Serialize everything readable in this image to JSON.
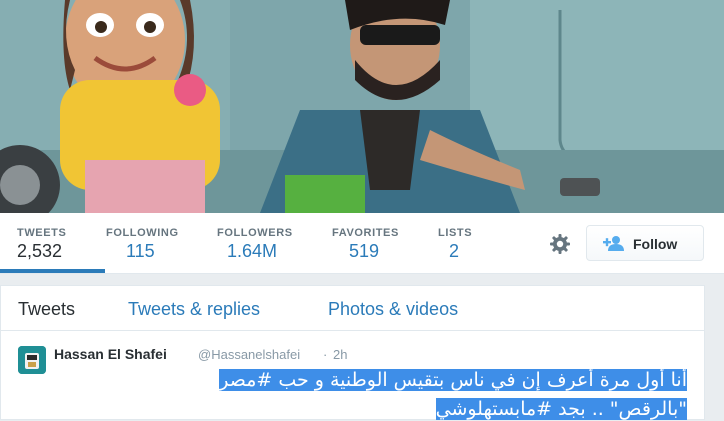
{
  "stats": [
    {
      "label": "TWEETS",
      "value": "2,532"
    },
    {
      "label": "FOLLOWING",
      "value": "115"
    },
    {
      "label": "FOLLOWERS",
      "value": "1.64M"
    },
    {
      "label": "FAVORITES",
      "value": "519"
    },
    {
      "label": "LISTS",
      "value": "2"
    }
  ],
  "follow_button": {
    "label": "Follow",
    "icon": "add-user-icon"
  },
  "settings_icon": "gear-icon",
  "timeline_tabs": [
    {
      "label": "Tweets"
    },
    {
      "label": "Tweets & replies"
    },
    {
      "label": "Photos & videos"
    }
  ],
  "tweet": {
    "name": "Hassan El Shafei",
    "handle": "@Hassanelshafei",
    "separator": "·",
    "time": "2h",
    "line1": "أنا أول مرة أعرف إن في ناس بتقيس الوطنية و حب #مصر",
    "line2": "\"بالرقص\" .. بجد #مابستهلوشي"
  },
  "colors": {
    "link": "#2b7bb9",
    "text": "#292f33",
    "muted": "#66757f",
    "selection": "#3e8ee8"
  }
}
